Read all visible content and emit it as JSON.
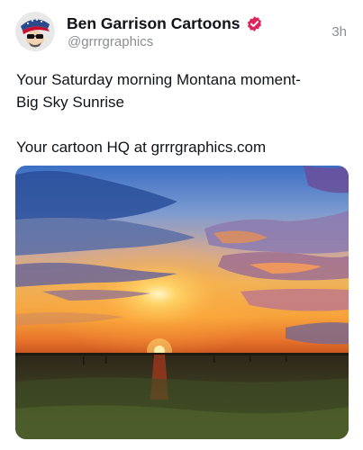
{
  "post": {
    "author": {
      "display_name": "Ben Garrison Cartoons",
      "handle": "@grrrgraphics",
      "verified": true,
      "avatar_icon": "cartoon-avatar-icon",
      "verified_icon": "verified-badge-icon",
      "badge_color": "#e0245e"
    },
    "timestamp": "3h",
    "text_lines": [
      "Your Saturday morning Montana moment-",
      "Big Sky Sunrise",
      "Your cartoon HQ at grrrgraphics.com"
    ],
    "media": {
      "type": "photo",
      "subject": "sunrise-landscape"
    }
  }
}
